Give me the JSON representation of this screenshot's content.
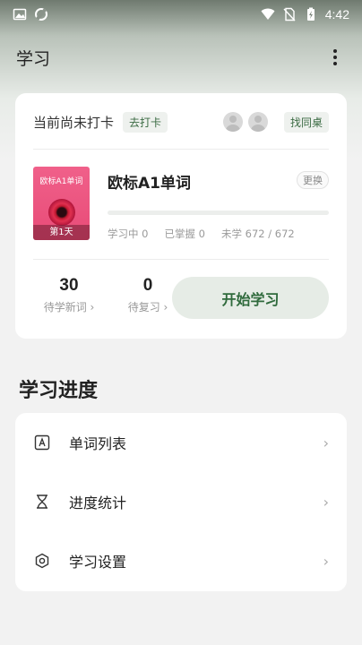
{
  "status_bar": {
    "time": "4:42"
  },
  "app_bar": {
    "title": "学习"
  },
  "study_card": {
    "checkin_status": "当前尚未打卡",
    "checkin_button": "去打卡",
    "find_partner_button": "找同桌",
    "book": {
      "cover_title": "欧标A1单词",
      "cover_day": "第1天",
      "name": "欧标A1单词",
      "change_button": "更换",
      "progress": 0,
      "learning": "学习中 0",
      "mastered": "已掌握 0",
      "unlearned": "未学 672 / 672"
    },
    "new_words": {
      "count": "30",
      "label": "待学新词 ›"
    },
    "review": {
      "count": "0",
      "label": "待复习 ›"
    },
    "start_button": "开始学习"
  },
  "progress_section": {
    "title": "学习进度",
    "items": [
      {
        "label": "单词列表",
        "icon": "word-list-icon"
      },
      {
        "label": "进度统计",
        "icon": "hourglass-icon"
      },
      {
        "label": "学习设置",
        "icon": "settings-hexagon-icon"
      }
    ]
  },
  "colors": {
    "accent": "#2f6a3c",
    "cover": "#e84b77"
  }
}
